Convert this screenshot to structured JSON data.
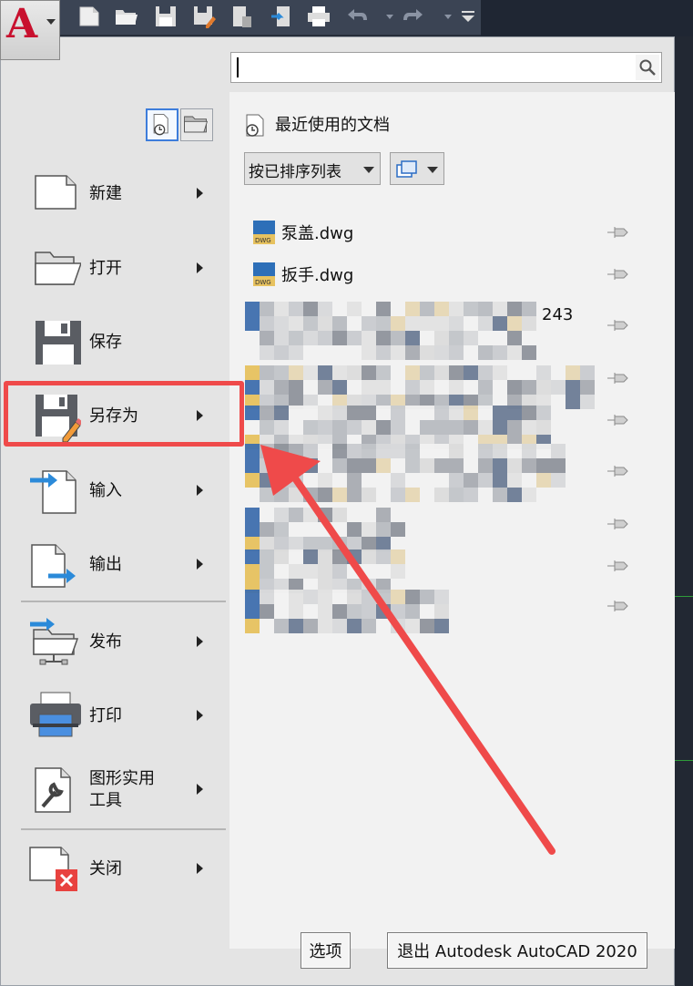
{
  "search": {
    "value": "",
    "placeholder": ""
  },
  "menu": {
    "items": [
      {
        "label": "新建",
        "icon": "new-document-icon",
        "submenu": true
      },
      {
        "label": "打开",
        "icon": "open-folder-icon",
        "submenu": true
      },
      {
        "label": "保存",
        "icon": "save-disk-icon",
        "submenu": false
      },
      {
        "label": "另存为",
        "icon": "save-as-icon",
        "submenu": true
      },
      {
        "label": "输入",
        "icon": "import-icon",
        "submenu": true
      },
      {
        "label": "输出",
        "icon": "export-icon",
        "submenu": true
      },
      {
        "label": "发布",
        "icon": "publish-icon",
        "submenu": true
      },
      {
        "label": "打印",
        "icon": "printer-icon",
        "submenu": true
      },
      {
        "label": "图形实用\n工具",
        "icon": "drawing-utilities-icon",
        "submenu": true
      },
      {
        "label": "关闭",
        "icon": "close-document-icon",
        "submenu": true
      }
    ]
  },
  "recent": {
    "title": "最近使用的文档",
    "sort_label": "按已排序列表",
    "files": [
      {
        "name": "泵盖.dwg",
        "blurred": false
      },
      {
        "name": "扳手.dwg",
        "blurred": false
      },
      {
        "name": "243",
        "blurred": true
      },
      {
        "name": "",
        "blurred": true
      },
      {
        "name": "",
        "blurred": true
      },
      {
        "name": "",
        "blurred": true
      },
      {
        "name": "",
        "blurred": true
      },
      {
        "name": "",
        "blurred": true
      },
      {
        "name": "",
        "blurred": true
      }
    ]
  },
  "footer": {
    "options_label": "选项",
    "exit_label": "退出 Autodesk AutoCAD 2020"
  },
  "colors": {
    "highlight": "#ef4a4a",
    "accent_blue": "#2b8ad9",
    "toolbar_bg": "#3b4454"
  }
}
